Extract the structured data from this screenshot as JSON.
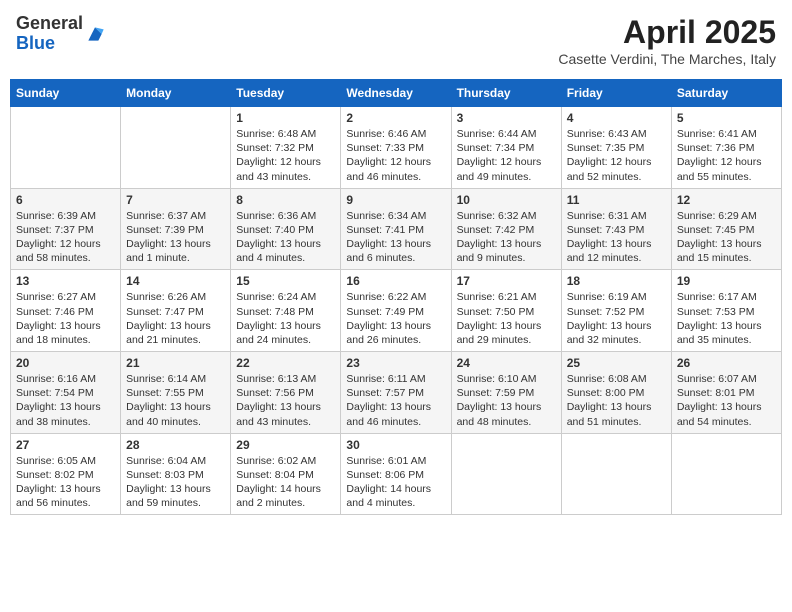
{
  "header": {
    "logo_general": "General",
    "logo_blue": "Blue",
    "month_title": "April 2025",
    "location": "Casette Verdini, The Marches, Italy"
  },
  "weekdays": [
    "Sunday",
    "Monday",
    "Tuesday",
    "Wednesday",
    "Thursday",
    "Friday",
    "Saturday"
  ],
  "weeks": [
    [
      null,
      null,
      {
        "day": "1",
        "sunrise": "6:48 AM",
        "sunset": "7:32 PM",
        "daylight": "12 hours and 43 minutes."
      },
      {
        "day": "2",
        "sunrise": "6:46 AM",
        "sunset": "7:33 PM",
        "daylight": "12 hours and 46 minutes."
      },
      {
        "day": "3",
        "sunrise": "6:44 AM",
        "sunset": "7:34 PM",
        "daylight": "12 hours and 49 minutes."
      },
      {
        "day": "4",
        "sunrise": "6:43 AM",
        "sunset": "7:35 PM",
        "daylight": "12 hours and 52 minutes."
      },
      {
        "day": "5",
        "sunrise": "6:41 AM",
        "sunset": "7:36 PM",
        "daylight": "12 hours and 55 minutes."
      }
    ],
    [
      {
        "day": "6",
        "sunrise": "6:39 AM",
        "sunset": "7:37 PM",
        "daylight": "12 hours and 58 minutes."
      },
      {
        "day": "7",
        "sunrise": "6:37 AM",
        "sunset": "7:39 PM",
        "daylight": "13 hours and 1 minute."
      },
      {
        "day": "8",
        "sunrise": "6:36 AM",
        "sunset": "7:40 PM",
        "daylight": "13 hours and 4 minutes."
      },
      {
        "day": "9",
        "sunrise": "6:34 AM",
        "sunset": "7:41 PM",
        "daylight": "13 hours and 6 minutes."
      },
      {
        "day": "10",
        "sunrise": "6:32 AM",
        "sunset": "7:42 PM",
        "daylight": "13 hours and 9 minutes."
      },
      {
        "day": "11",
        "sunrise": "6:31 AM",
        "sunset": "7:43 PM",
        "daylight": "13 hours and 12 minutes."
      },
      {
        "day": "12",
        "sunrise": "6:29 AM",
        "sunset": "7:45 PM",
        "daylight": "13 hours and 15 minutes."
      }
    ],
    [
      {
        "day": "13",
        "sunrise": "6:27 AM",
        "sunset": "7:46 PM",
        "daylight": "13 hours and 18 minutes."
      },
      {
        "day": "14",
        "sunrise": "6:26 AM",
        "sunset": "7:47 PM",
        "daylight": "13 hours and 21 minutes."
      },
      {
        "day": "15",
        "sunrise": "6:24 AM",
        "sunset": "7:48 PM",
        "daylight": "13 hours and 24 minutes."
      },
      {
        "day": "16",
        "sunrise": "6:22 AM",
        "sunset": "7:49 PM",
        "daylight": "13 hours and 26 minutes."
      },
      {
        "day": "17",
        "sunrise": "6:21 AM",
        "sunset": "7:50 PM",
        "daylight": "13 hours and 29 minutes."
      },
      {
        "day": "18",
        "sunrise": "6:19 AM",
        "sunset": "7:52 PM",
        "daylight": "13 hours and 32 minutes."
      },
      {
        "day": "19",
        "sunrise": "6:17 AM",
        "sunset": "7:53 PM",
        "daylight": "13 hours and 35 minutes."
      }
    ],
    [
      {
        "day": "20",
        "sunrise": "6:16 AM",
        "sunset": "7:54 PM",
        "daylight": "13 hours and 38 minutes."
      },
      {
        "day": "21",
        "sunrise": "6:14 AM",
        "sunset": "7:55 PM",
        "daylight": "13 hours and 40 minutes."
      },
      {
        "day": "22",
        "sunrise": "6:13 AM",
        "sunset": "7:56 PM",
        "daylight": "13 hours and 43 minutes."
      },
      {
        "day": "23",
        "sunrise": "6:11 AM",
        "sunset": "7:57 PM",
        "daylight": "13 hours and 46 minutes."
      },
      {
        "day": "24",
        "sunrise": "6:10 AM",
        "sunset": "7:59 PM",
        "daylight": "13 hours and 48 minutes."
      },
      {
        "day": "25",
        "sunrise": "6:08 AM",
        "sunset": "8:00 PM",
        "daylight": "13 hours and 51 minutes."
      },
      {
        "day": "26",
        "sunrise": "6:07 AM",
        "sunset": "8:01 PM",
        "daylight": "13 hours and 54 minutes."
      }
    ],
    [
      {
        "day": "27",
        "sunrise": "6:05 AM",
        "sunset": "8:02 PM",
        "daylight": "13 hours and 56 minutes."
      },
      {
        "day": "28",
        "sunrise": "6:04 AM",
        "sunset": "8:03 PM",
        "daylight": "13 hours and 59 minutes."
      },
      {
        "day": "29",
        "sunrise": "6:02 AM",
        "sunset": "8:04 PM",
        "daylight": "14 hours and 2 minutes."
      },
      {
        "day": "30",
        "sunrise": "6:01 AM",
        "sunset": "8:06 PM",
        "daylight": "14 hours and 4 minutes."
      },
      null,
      null,
      null
    ]
  ],
  "labels": {
    "sunrise": "Sunrise:",
    "sunset": "Sunset:",
    "daylight": "Daylight:"
  }
}
